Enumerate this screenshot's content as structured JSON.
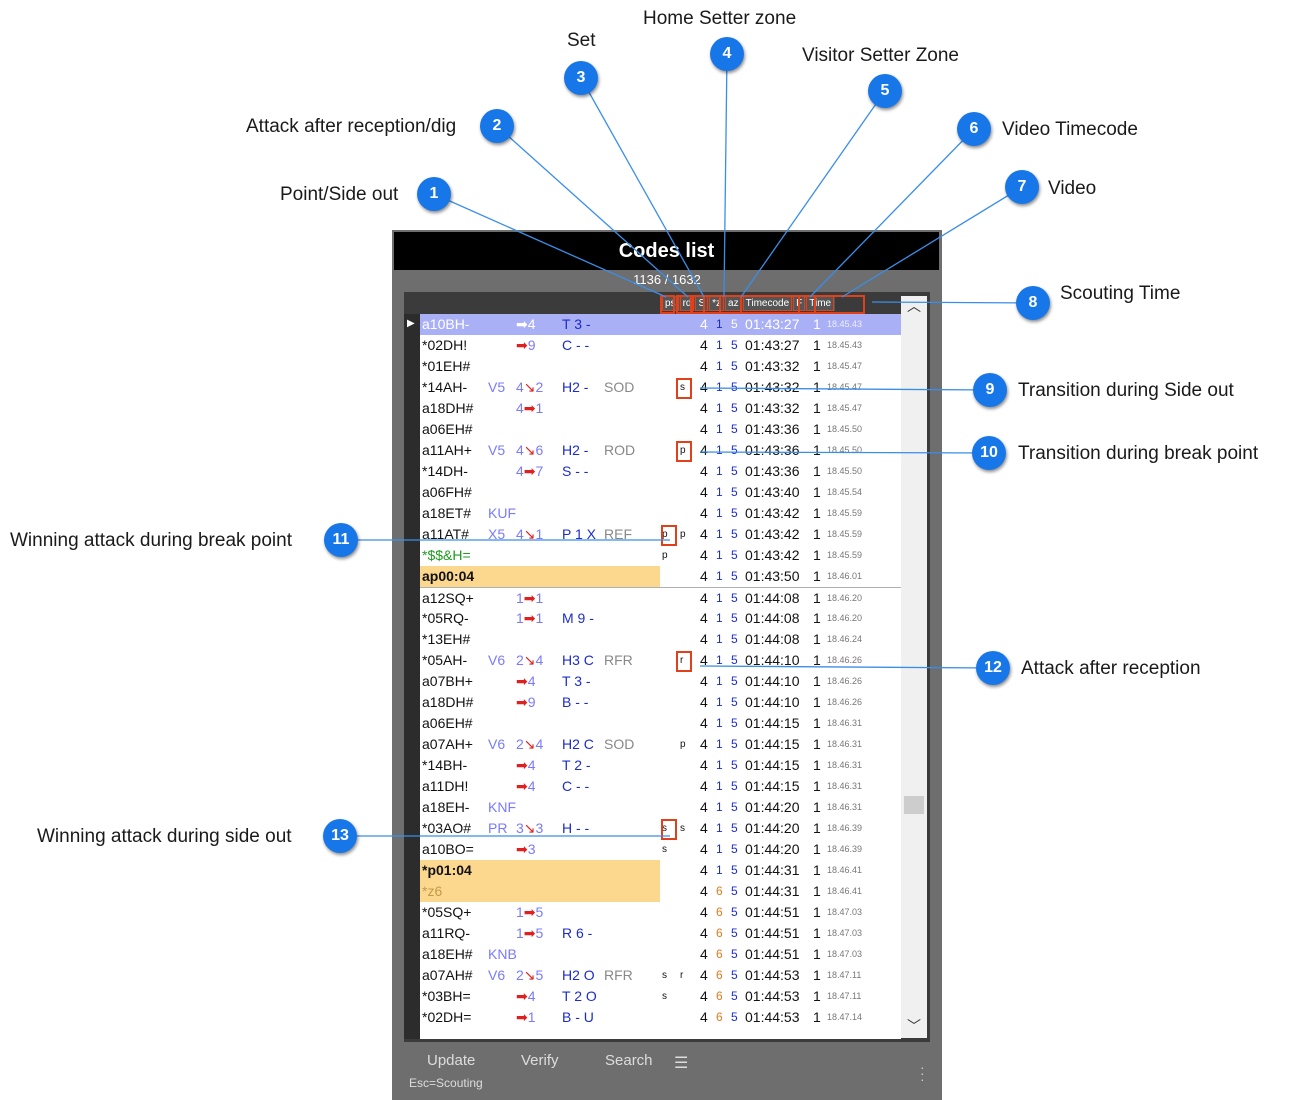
{
  "callouts": [
    {
      "n": "1",
      "label": "Point/Side out"
    },
    {
      "n": "2",
      "label": "Attack after reception/dig"
    },
    {
      "n": "3",
      "label": "Set"
    },
    {
      "n": "4",
      "label": "Home Setter zone"
    },
    {
      "n": "5",
      "label": "Visitor Setter Zone"
    },
    {
      "n": "6",
      "label": "Video Timecode"
    },
    {
      "n": "7",
      "label": "Video"
    },
    {
      "n": "8",
      "label": "Scouting Time"
    },
    {
      "n": "9",
      "label": "Transition during Side out"
    },
    {
      "n": "10",
      "label": "Transition during break point"
    },
    {
      "n": "11",
      "label": "Winning attack during break point"
    },
    {
      "n": "12",
      "label": "Attack after reception"
    },
    {
      "n": "13",
      "label": "Winning attack during side out"
    }
  ],
  "window": {
    "title": "Codes list",
    "counter": "1136 / 1632",
    "columns": [
      "ps",
      "rd",
      "S",
      "*z",
      "az",
      "Timecode",
      "F",
      "Time"
    ]
  },
  "rows": [
    {
      "code": "a10BH-",
      "a": "",
      "b": "➡4",
      "c": "T 3 -",
      "d": "",
      "ps": "",
      "rd": "",
      "s": "4",
      "hz": "1",
      "vz": "5",
      "tc": "01:43:27",
      "f": "1",
      "tm": "18.45.43",
      "style": "sel"
    },
    {
      "code": "*02DH!",
      "a": "",
      "b": "➡9",
      "c": "C - -",
      "d": "",
      "ps": "",
      "rd": "",
      "s": "4",
      "hz": "1",
      "vz": "5",
      "tc": "01:43:27",
      "f": "1",
      "tm": "18.45.43"
    },
    {
      "code": "*01EH#",
      "a": "",
      "b": "",
      "c": "",
      "d": "",
      "ps": "",
      "rd": "",
      "s": "4",
      "hz": "1",
      "vz": "5",
      "tc": "01:43:32",
      "f": "1",
      "tm": "18.45.47"
    },
    {
      "code": "*14AH-",
      "a": "V5",
      "b": "4↘2",
      "c": "H2 -",
      "d": "SOD",
      "ps": "",
      "rd": "s",
      "s": "4",
      "hz": "1",
      "vz": "5",
      "tc": "01:43:32",
      "f": "1",
      "tm": "18.45.47"
    },
    {
      "code": "a18DH#",
      "a": "",
      "b": "4➡1",
      "c": "",
      "d": "",
      "ps": "",
      "rd": "",
      "s": "4",
      "hz": "1",
      "vz": "5",
      "tc": "01:43:32",
      "f": "1",
      "tm": "18.45.47"
    },
    {
      "code": "a06EH#",
      "a": "",
      "b": "",
      "c": "",
      "d": "",
      "ps": "",
      "rd": "",
      "s": "4",
      "hz": "1",
      "vz": "5",
      "tc": "01:43:36",
      "f": "1",
      "tm": "18.45.50"
    },
    {
      "code": "a11AH+",
      "a": "V5",
      "b": "4↘6",
      "c": "H2 -",
      "d": "ROD",
      "ps": "",
      "rd": "p",
      "s": "4",
      "hz": "1",
      "vz": "5",
      "tc": "01:43:36",
      "f": "1",
      "tm": "18.45.50"
    },
    {
      "code": "*14DH-",
      "a": "",
      "b": "4➡7",
      "c": "S - -",
      "d": "",
      "ps": "",
      "rd": "",
      "s": "4",
      "hz": "1",
      "vz": "5",
      "tc": "01:43:36",
      "f": "1",
      "tm": "18.45.50"
    },
    {
      "code": "a06FH#",
      "a": "",
      "b": "",
      "c": "",
      "d": "",
      "ps": "",
      "rd": "",
      "s": "4",
      "hz": "1",
      "vz": "5",
      "tc": "01:43:40",
      "f": "1",
      "tm": "18.45.54"
    },
    {
      "code": "a18ET#",
      "a": "KUF",
      "b": "",
      "c": "",
      "d": "",
      "ps": "",
      "rd": "",
      "s": "4",
      "hz": "1",
      "vz": "5",
      "tc": "01:43:42",
      "f": "1",
      "tm": "18.45.59"
    },
    {
      "code": "a11AT#",
      "a": "X5",
      "b": "4↘1",
      "c": "P 1 X",
      "d": "REF",
      "ps": "p",
      "rd": "p",
      "s": "4",
      "hz": "1",
      "vz": "5",
      "tc": "01:43:42",
      "f": "1",
      "tm": "18.45.59"
    },
    {
      "code": "*$$&H=",
      "a": "",
      "b": "",
      "c": "",
      "d": "",
      "ps": "p",
      "rd": "",
      "s": "4",
      "hz": "1",
      "vz": "5",
      "tc": "01:43:42",
      "f": "1",
      "tm": "18.45.59",
      "style": "pen"
    },
    {
      "code": "ap00:04",
      "a": "",
      "b": "",
      "c": "",
      "d": "",
      "ps": "",
      "rd": "",
      "s": "4",
      "hz": "1",
      "vz": "5",
      "tc": "01:43:50",
      "f": "1",
      "tm": "18.46.01",
      "style": "hl"
    },
    {
      "code": "a12SQ+",
      "a": "",
      "b": "1➡1",
      "c": "",
      "d": "",
      "ps": "",
      "rd": "",
      "s": "4",
      "hz": "1",
      "vz": "5",
      "tc": "01:44:08",
      "f": "1",
      "tm": "18.46.20",
      "style": "sep"
    },
    {
      "code": "*05RQ-",
      "a": "",
      "b": "1➡1",
      "c": "M 9 -",
      "d": "",
      "ps": "",
      "rd": "",
      "s": "4",
      "hz": "1",
      "vz": "5",
      "tc": "01:44:08",
      "f": "1",
      "tm": "18.46.20"
    },
    {
      "code": "*13EH#",
      "a": "",
      "b": "",
      "c": "",
      "d": "",
      "ps": "",
      "rd": "",
      "s": "4",
      "hz": "1",
      "vz": "5",
      "tc": "01:44:08",
      "f": "1",
      "tm": "18.46.24"
    },
    {
      "code": "*05AH-",
      "a": "V6",
      "b": "2↘4",
      "c": "H3 C",
      "d": "RFR",
      "ps": "",
      "rd": "r",
      "s": "4",
      "hz": "1",
      "vz": "5",
      "tc": "01:44:10",
      "f": "1",
      "tm": "18.46.26"
    },
    {
      "code": "a07BH+",
      "a": "",
      "b": "➡4",
      "c": "T 3 -",
      "d": "",
      "ps": "",
      "rd": "",
      "s": "4",
      "hz": "1",
      "vz": "5",
      "tc": "01:44:10",
      "f": "1",
      "tm": "18.46.26"
    },
    {
      "code": "a18DH#",
      "a": "",
      "b": "➡9",
      "c": "B - -",
      "d": "",
      "ps": "",
      "rd": "",
      "s": "4",
      "hz": "1",
      "vz": "5",
      "tc": "01:44:10",
      "f": "1",
      "tm": "18.46.26"
    },
    {
      "code": "a06EH#",
      "a": "",
      "b": "",
      "c": "",
      "d": "",
      "ps": "",
      "rd": "",
      "s": "4",
      "hz": "1",
      "vz": "5",
      "tc": "01:44:15",
      "f": "1",
      "tm": "18.46.31"
    },
    {
      "code": "a07AH+",
      "a": "V6",
      "b": "2↘4",
      "c": "H2 C",
      "d": "SOD",
      "ps": "",
      "rd": "p",
      "s": "4",
      "hz": "1",
      "vz": "5",
      "tc": "01:44:15",
      "f": "1",
      "tm": "18.46.31"
    },
    {
      "code": "*14BH-",
      "a": "",
      "b": "➡4",
      "c": "T 2 -",
      "d": "",
      "ps": "",
      "rd": "",
      "s": "4",
      "hz": "1",
      "vz": "5",
      "tc": "01:44:15",
      "f": "1",
      "tm": "18.46.31"
    },
    {
      "code": "a11DH!",
      "a": "",
      "b": "➡4",
      "c": "C - -",
      "d": "",
      "ps": "",
      "rd": "",
      "s": "4",
      "hz": "1",
      "vz": "5",
      "tc": "01:44:15",
      "f": "1",
      "tm": "18.46.31"
    },
    {
      "code": "a18EH-",
      "a": "KNF",
      "b": "",
      "c": "",
      "d": "",
      "ps": "",
      "rd": "",
      "s": "4",
      "hz": "1",
      "vz": "5",
      "tc": "01:44:20",
      "f": "1",
      "tm": "18.46.31"
    },
    {
      "code": "*03AO#",
      "a": "PR",
      "b": "3↘3",
      "c": "H - -",
      "d": "",
      "ps": "s",
      "rd": "s",
      "s": "4",
      "hz": "1",
      "vz": "5",
      "tc": "01:44:20",
      "f": "1",
      "tm": "18.46.39"
    },
    {
      "code": "a10BO=",
      "a": "",
      "b": "➡3",
      "c": "",
      "d": "",
      "ps": "s",
      "rd": "",
      "s": "4",
      "hz": "1",
      "vz": "5",
      "tc": "01:44:20",
      "f": "1",
      "tm": "18.46.39"
    },
    {
      "code": "*p01:04",
      "a": "",
      "b": "",
      "c": "",
      "d": "",
      "ps": "",
      "rd": "",
      "s": "4",
      "hz": "1",
      "vz": "5",
      "tc": "01:44:31",
      "f": "1",
      "tm": "18.46.41",
      "style": "hl"
    },
    {
      "code": "*z6",
      "a": "",
      "b": "",
      "c": "",
      "d": "",
      "ps": "",
      "rd": "",
      "s": "4",
      "hz": "6",
      "vz": "5",
      "tc": "01:44:31",
      "f": "1",
      "tm": "18.46.41",
      "style": "hlz"
    },
    {
      "code": "*05SQ+",
      "a": "",
      "b": "1➡5",
      "c": "",
      "d": "",
      "ps": "",
      "rd": "",
      "s": "4",
      "hz": "6",
      "vz": "5",
      "tc": "01:44:51",
      "f": "1",
      "tm": "18.47.03"
    },
    {
      "code": "a11RQ-",
      "a": "",
      "b": "1➡5",
      "c": "R 6 -",
      "d": "",
      "ps": "",
      "rd": "",
      "s": "4",
      "hz": "6",
      "vz": "5",
      "tc": "01:44:51",
      "f": "1",
      "tm": "18.47.03"
    },
    {
      "code": "a18EH#",
      "a": "KNB",
      "b": "",
      "c": "",
      "d": "",
      "ps": "",
      "rd": "",
      "s": "4",
      "hz": "6",
      "vz": "5",
      "tc": "01:44:51",
      "f": "1",
      "tm": "18.47.03"
    },
    {
      "code": "a07AH#",
      "a": "V6",
      "b": "2↘5",
      "c": "H2 O",
      "d": "RFR",
      "ps": "s",
      "rd": "r",
      "s": "4",
      "hz": "6",
      "vz": "5",
      "tc": "01:44:53",
      "f": "1",
      "tm": "18.47.11"
    },
    {
      "code": "*03BH=",
      "a": "",
      "b": "➡4",
      "c": "T 2 O",
      "d": "",
      "ps": "s",
      "rd": "",
      "s": "4",
      "hz": "6",
      "vz": "5",
      "tc": "01:44:53",
      "f": "1",
      "tm": "18.47.11"
    },
    {
      "code": "*02DH=",
      "a": "",
      "b": "➡1",
      "c": "B - U",
      "d": "",
      "ps": "",
      "rd": "",
      "s": "4",
      "hz": "6",
      "vz": "5",
      "tc": "01:44:53",
      "f": "1",
      "tm": "18.47.14"
    }
  ],
  "buttons": {
    "update": "Update",
    "verify": "Verify",
    "search": "Search"
  },
  "esc_hint": "Esc=Scouting",
  "colors": {
    "badge": "#1877e8",
    "highlight": "#e0401a",
    "selected_row": "#aab0f6",
    "point_row": "#fcd88e"
  }
}
